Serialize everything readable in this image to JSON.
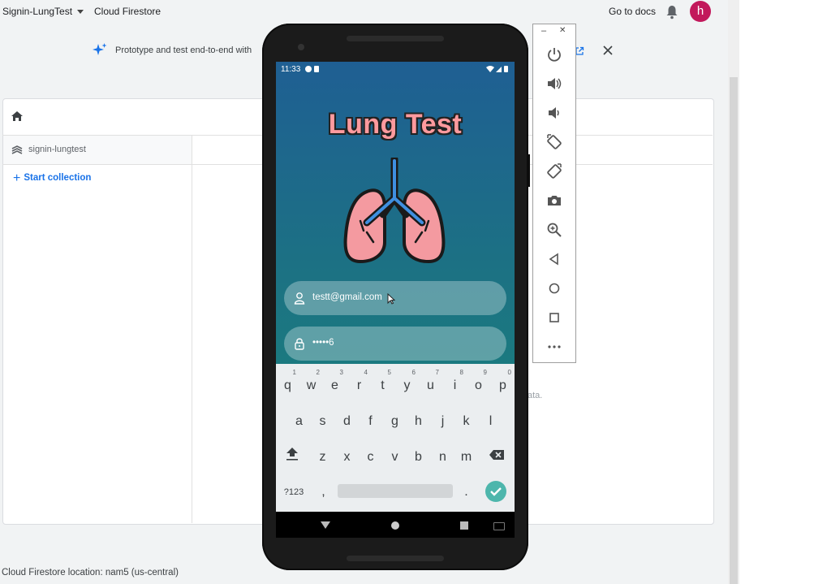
{
  "console": {
    "project_name": "Signin-LungTest",
    "product_name": "Cloud Firestore",
    "go_to_docs": "Go to docs",
    "avatar_initial": "h",
    "banner_text": "Prototype and test end-to-end with",
    "database_name": "signin-lungtest",
    "start_collection": "Start collection",
    "faint_text": "ata.",
    "location": "Cloud Firestore location: nam5 (us-central)"
  },
  "phone": {
    "status_time": "11:33",
    "app_title": "Lung Test",
    "email_value": "testt@gmail.com",
    "password_value": "•••••6",
    "keyboard": {
      "row1": [
        [
          "q",
          "1"
        ],
        [
          "w",
          "2"
        ],
        [
          "e",
          "3"
        ],
        [
          "r",
          "4"
        ],
        [
          "t",
          "5"
        ],
        [
          "y",
          "6"
        ],
        [
          "u",
          "7"
        ],
        [
          "i",
          "8"
        ],
        [
          "o",
          "9"
        ],
        [
          "p",
          "0"
        ]
      ],
      "row2": [
        "a",
        "s",
        "d",
        "f",
        "g",
        "h",
        "j",
        "k",
        "l"
      ],
      "row3": [
        "z",
        "x",
        "c",
        "v",
        "b",
        "n",
        "m"
      ],
      "symbols": "?123",
      "comma": ",",
      "period": "."
    }
  },
  "colors": {
    "accent": "#1a73e8",
    "avatar": "#c2185b",
    "title_pink": "#ff9a9e",
    "done_button": "#4db6ac"
  },
  "emulator_icons": [
    "power-icon",
    "volume-up-icon",
    "volume-down-icon",
    "rotate-left-icon",
    "rotate-right-icon",
    "camera-icon",
    "zoom-icon",
    "back-icon",
    "home-icon",
    "overview-icon",
    "more-icon"
  ]
}
